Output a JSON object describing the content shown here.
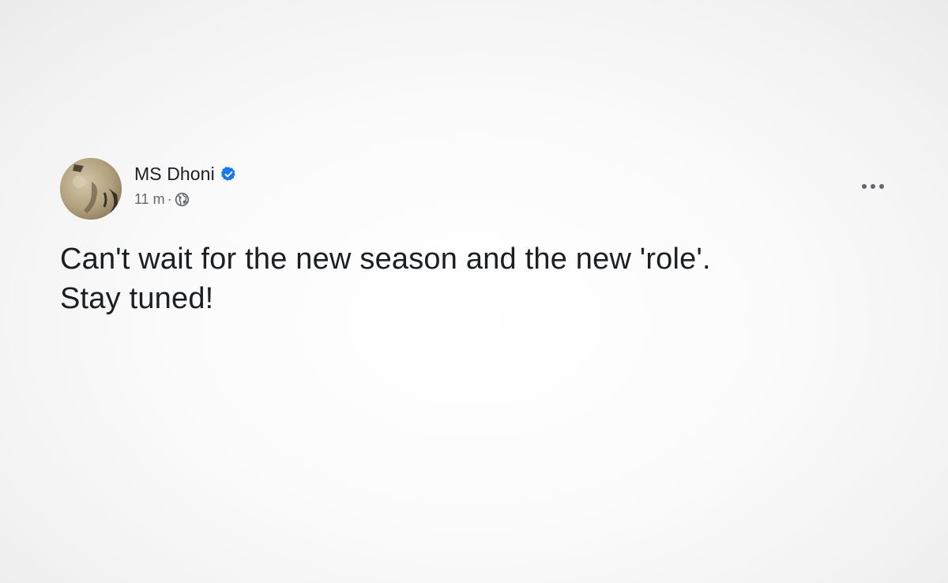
{
  "post": {
    "author": {
      "name": "MS Dhoni",
      "verified": true,
      "avatar_icon": "profile-photo"
    },
    "timestamp": "11 m",
    "separator": "·",
    "audience_icon": "globe-icon",
    "options_icon": "more-horizontal-icon",
    "text_lines": [
      "Can't wait for the new season and the new 'role'.",
      "Stay tuned!"
    ]
  },
  "colors": {
    "verified_badge": "#1877f2",
    "primary_text": "#1c1e21",
    "secondary_text": "#65676b"
  }
}
